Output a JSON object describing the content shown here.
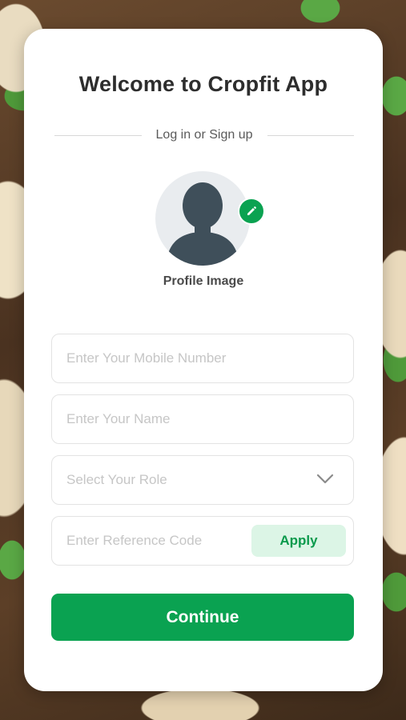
{
  "app": {
    "title": "Welcome to Cropfit App",
    "subtitle": "Log in or Sign up"
  },
  "profile": {
    "label": "Profile Image",
    "avatar_icon": "person-silhouette-icon",
    "edit_icon": "pencil-icon"
  },
  "form": {
    "mobile_placeholder": "Enter Your Mobile Number",
    "name_placeholder": "Enter Your Name",
    "role_placeholder": "Select Your Role",
    "reference_placeholder": "Enter Reference Code",
    "apply_label": "Apply",
    "continue_label": "Continue"
  },
  "colors": {
    "accent": "#0aa251",
    "apply_bg": "#dcf5e6",
    "avatar_bg": "#e9ecef",
    "avatar_figure": "#3f4f5a"
  }
}
